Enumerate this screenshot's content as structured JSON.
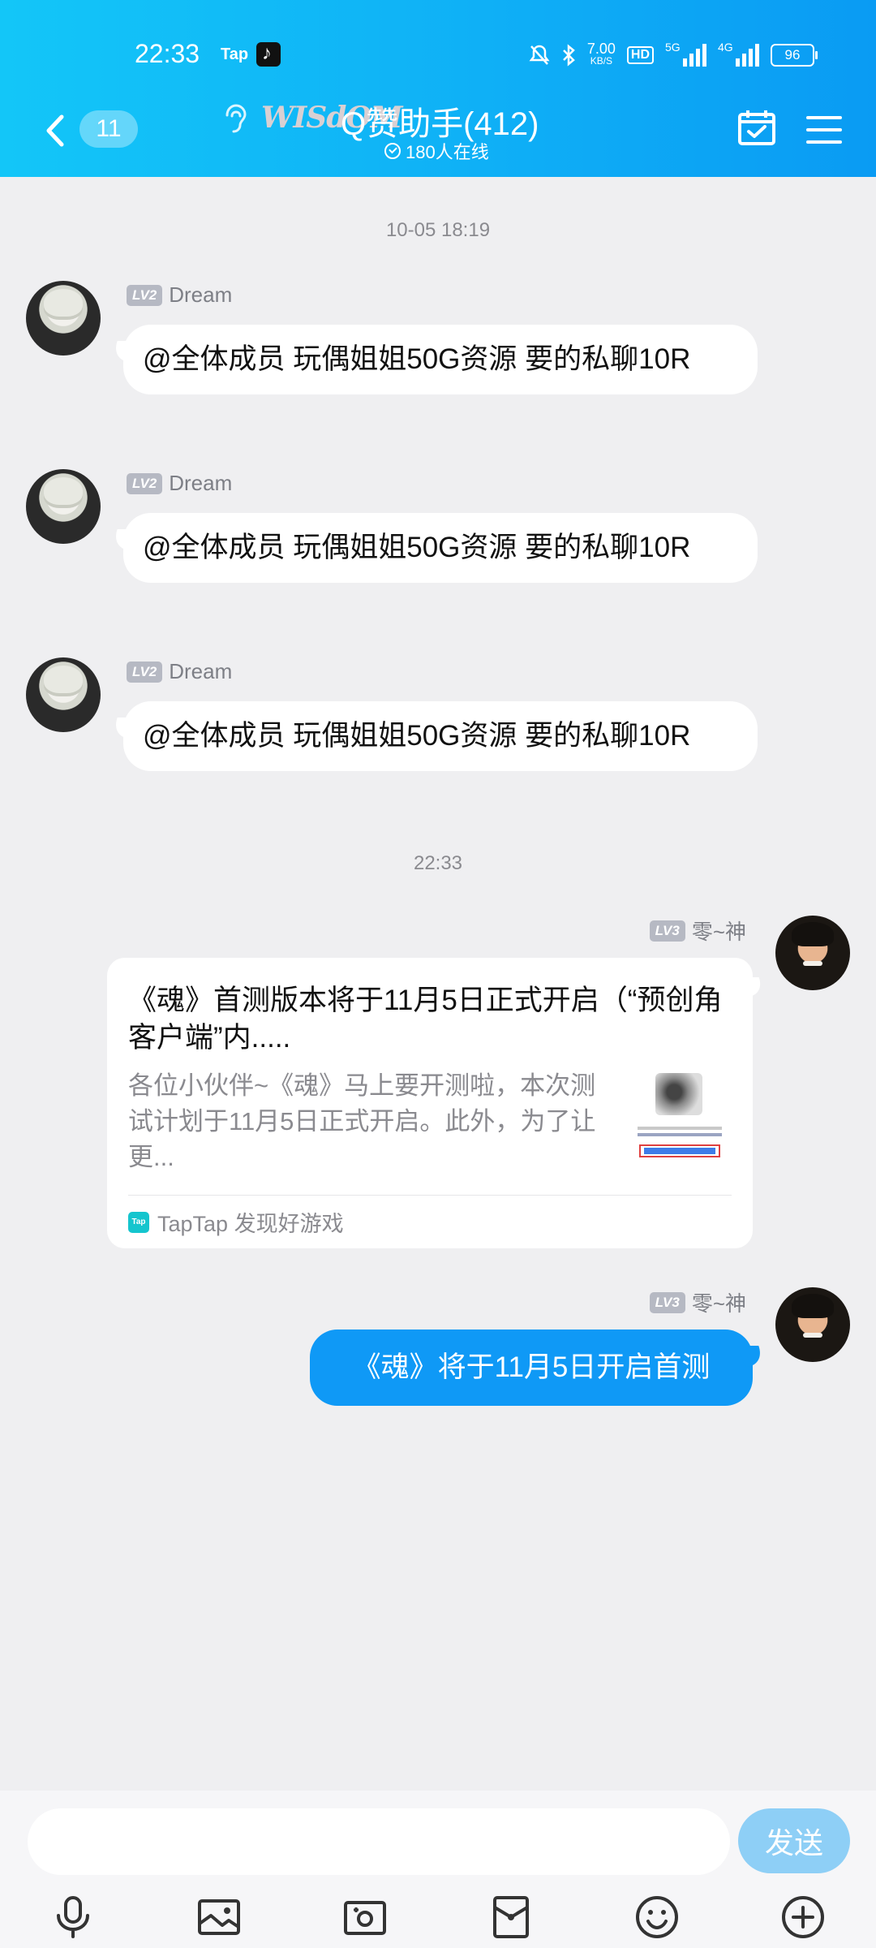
{
  "status_bar": {
    "time": "22:33",
    "app_label": "Tap",
    "net_speed_value": "7.00",
    "net_speed_unit": "KB/S",
    "hd_label": "HD",
    "signal_1": "5G",
    "signal_2": "4G",
    "battery": "96"
  },
  "header": {
    "unread_count": "11",
    "group_logo_text": "WISdOM",
    "group_name": "Q赞助手(412)",
    "online_text": "180人在线"
  },
  "chat": {
    "timestamp_1": "10-05 18:19",
    "incoming": [
      {
        "level": "LV2",
        "sender": "Dream",
        "text": "@全体成员 玩偶姐姐50G资源 要的私聊10R"
      },
      {
        "level": "LV2",
        "sender": "Dream",
        "text": "@全体成员 玩偶姐姐50G资源 要的私聊10R"
      },
      {
        "level": "LV2",
        "sender": "Dream",
        "text": "@全体成员 玩偶姐姐50G资源 要的私聊10R"
      }
    ],
    "timestamp_2": "22:33",
    "card_message": {
      "level": "LV3",
      "sender": "零~神",
      "title": "《魂》首测版本将于11月5日正式开启（“预创角客户端”内.....",
      "description": "各位小伙伴~《魂》马上要开测啦，本次测试计划于11月5日正式开启。此外，为了让更...",
      "source": "TapTap 发现好游戏",
      "source_logo": "Tap"
    },
    "outgoing": {
      "level": "LV3",
      "sender": "零~神",
      "text": "《魂》将于11月5日开启首测"
    }
  },
  "input_bar": {
    "placeholder": "",
    "send_label": "发送"
  },
  "toolbar": [
    "mic-icon",
    "image-icon",
    "camera-icon",
    "red-packet-icon",
    "emoji-icon",
    "plus-icon"
  ]
}
